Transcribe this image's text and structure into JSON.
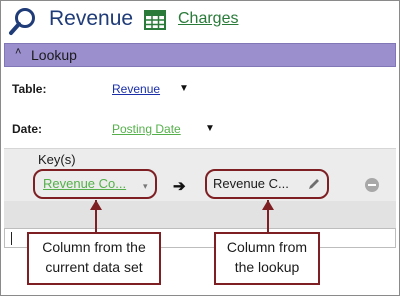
{
  "header": {
    "title": "Revenue",
    "charges_link": "Charges"
  },
  "lookup_section": {
    "label": "Lookup",
    "collapse_glyph": "˄"
  },
  "fields": {
    "table": {
      "label": "Table:",
      "value": "Revenue",
      "value_color": "#1a2fa8"
    },
    "date": {
      "label": "Date:",
      "value": "Posting Date",
      "value_color": "#55b04b"
    }
  },
  "keys": {
    "label": "Key(s)",
    "left_value": "Revenue Co...",
    "right_value": "Revenue C...",
    "map_glyph": "➔",
    "dropdown_glyph": "▾"
  },
  "callouts": {
    "left": "Column from the current data set",
    "right": "Column from the lookup"
  },
  "colors": {
    "accent_bar": "#9b8fce",
    "callout_border": "#7e1f23",
    "link_green": "#2a7b3a"
  }
}
